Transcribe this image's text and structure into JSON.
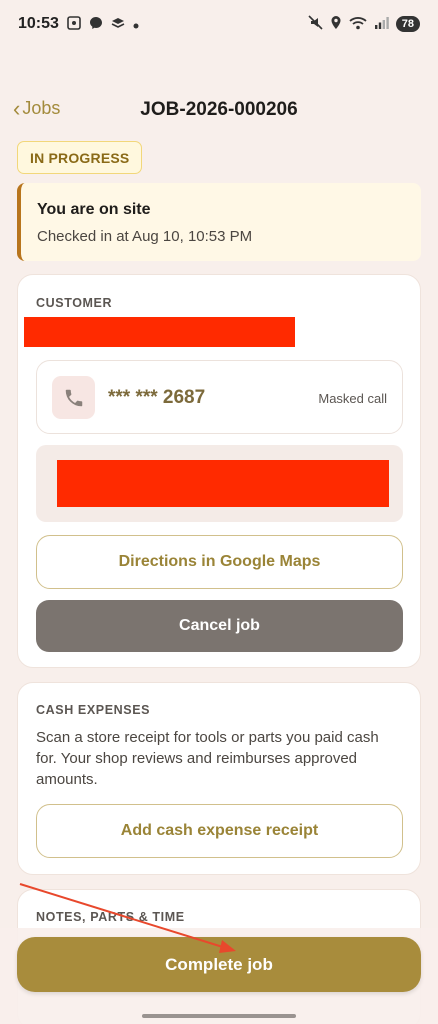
{
  "status_bar": {
    "time": "10:53",
    "left_icons": [
      "screenshot-icon",
      "messenger-icon",
      "stack-icon",
      "dot-icon"
    ],
    "right_icons": [
      "mute-icon",
      "location-icon",
      "wifi-icon",
      "signal-icon"
    ],
    "battery": "78"
  },
  "nav": {
    "back_label": "Jobs",
    "title": "JOB-2026-000206"
  },
  "job_status": "IN PROGRESS",
  "onsite": {
    "title": "You are on site",
    "subtitle": "Checked in at Aug 10, 10:53 PM"
  },
  "customer": {
    "section_label": "CUSTOMER",
    "phone_masked": "*** *** 2687",
    "masked_call_label": "Masked call",
    "directions_label": "Directions in Google Maps",
    "cancel_label": "Cancel job"
  },
  "cash_expenses": {
    "section_label": "CASH EXPENSES",
    "description": "Scan a store receipt for tools or parts you paid cash for. Your shop reviews and reimburses approved amounts.",
    "add_label": "Add cash expense receipt"
  },
  "notes": {
    "section_label": "NOTES, PARTS & TIME"
  },
  "complete_label": "Complete job",
  "colors": {
    "background": "#f8efeb",
    "accent": "#a88c3c",
    "status_chip_border": "#f2d77a",
    "onsite_border": "#b8751d",
    "cancel_button": "#7b746f",
    "redaction": "#ff2a00",
    "annotation_arrow": "#e8482c"
  }
}
